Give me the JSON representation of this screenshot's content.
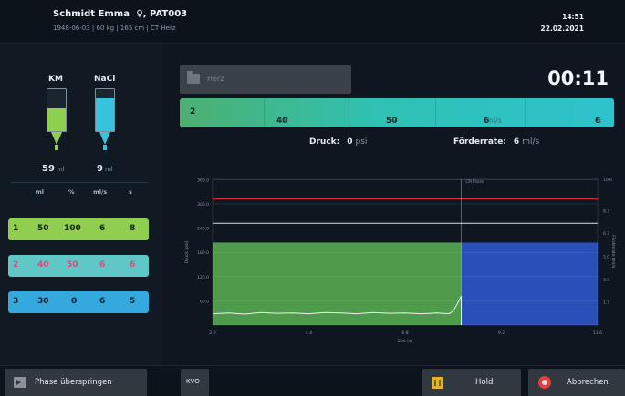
{
  "header": {
    "patient_name": "Schmidt Emma",
    "gender_symbol": "♀",
    "patient_id": "PAT003",
    "patient_details": "1948-06-03 | 60 kg | 165 cm | CT Herz",
    "time": "14:51",
    "date": "22.02.2021"
  },
  "bottles": [
    {
      "label": "KM",
      "value": "59",
      "unit": "ml",
      "color": "#8fcf4f",
      "fill_fraction": 0.55
    },
    {
      "label": "NaCl",
      "value": "9",
      "unit": "ml",
      "color": "#35c3dd",
      "fill_fraction": 0.78
    }
  ],
  "phase_table": {
    "headers": [
      "ml",
      "%",
      "ml/s",
      "s"
    ],
    "rows": [
      {
        "phase": "1",
        "ml": "50",
        "percent": "100",
        "rate": "6",
        "sec": "8",
        "bg": "#8fce4e",
        "fg": "#14210b"
      },
      {
        "phase": "2",
        "ml": "40",
        "percent": "50",
        "rate": "6",
        "sec": "6",
        "bg": "#5fc8c7",
        "fg": "#e8457a"
      },
      {
        "phase": "3",
        "ml": "30",
        "percent": "0",
        "rate": "6",
        "sec": "5",
        "bg": "#34a9dd",
        "fg": "#0b1826"
      }
    ]
  },
  "protocol": {
    "name": "Herz"
  },
  "timer": "00:11",
  "active_phase": {
    "phase": "2",
    "volume": "40",
    "volume_unit": "ml",
    "percent": "50",
    "percent_unit": "%",
    "rate": "6",
    "rate_unit": "ml/s",
    "duration": "6",
    "duration_unit": "s"
  },
  "status": {
    "pressure_label": "Druck:",
    "pressure_value": "0",
    "pressure_unit": "psi",
    "flow_label": "Förderrate:",
    "flow_value": "6",
    "flow_unit": "ml/s"
  },
  "chart_data": {
    "type": "area",
    "xlabel": "Zeit (s)",
    "ylabel": "Druck (psi)",
    "y2label": "Förderrate (ml/s)",
    "xlim": [
      2.0,
      11.6
    ],
    "ylim": [
      0,
      360.8
    ],
    "y2lim": [
      0,
      10.6
    ],
    "x_ticks": [
      "2.0",
      "4.4",
      "6.8",
      "9.2",
      "11.6"
    ],
    "y_ticks": [
      "60.0",
      "120.0",
      "180.0",
      "240.0",
      "300.0",
      "360.0"
    ],
    "y2_ticks": [
      "1.7",
      "3.3",
      "5.0",
      "6.7",
      "8.3",
      "10.6"
    ],
    "limit_line": {
      "y": 312,
      "color": "#c8313a"
    },
    "upper_line": {
      "y": 252,
      "color": "#d8dde2"
    },
    "phase_marker": {
      "x": 8.2,
      "label": "CM Phase"
    },
    "phases": [
      {
        "x_start": 2.0,
        "x_end": 8.2,
        "rate": 6,
        "color": "#4f9b4c"
      },
      {
        "x_start": 8.2,
        "x_end": 11.6,
        "rate": 6,
        "color": "#2a4fb8"
      }
    ],
    "pressure_series": {
      "name": "Druck",
      "x": [
        2.0,
        2.4,
        2.8,
        3.2,
        3.6,
        4.0,
        4.4,
        4.8,
        5.2,
        5.6,
        6.0,
        6.4,
        6.8,
        7.2,
        7.6,
        7.9,
        8.0,
        8.1,
        8.2
      ],
      "y": [
        28,
        30,
        27,
        31,
        29,
        30,
        28,
        31,
        30,
        28,
        31,
        29,
        30,
        28,
        30,
        28,
        35,
        52,
        72
      ],
      "color": "#f0f0f0"
    }
  },
  "footer": {
    "skip_label": "Phase überspringen",
    "kvo_label": "KVO",
    "hold_label": "Hold",
    "cancel_label": "Abbrechen"
  }
}
